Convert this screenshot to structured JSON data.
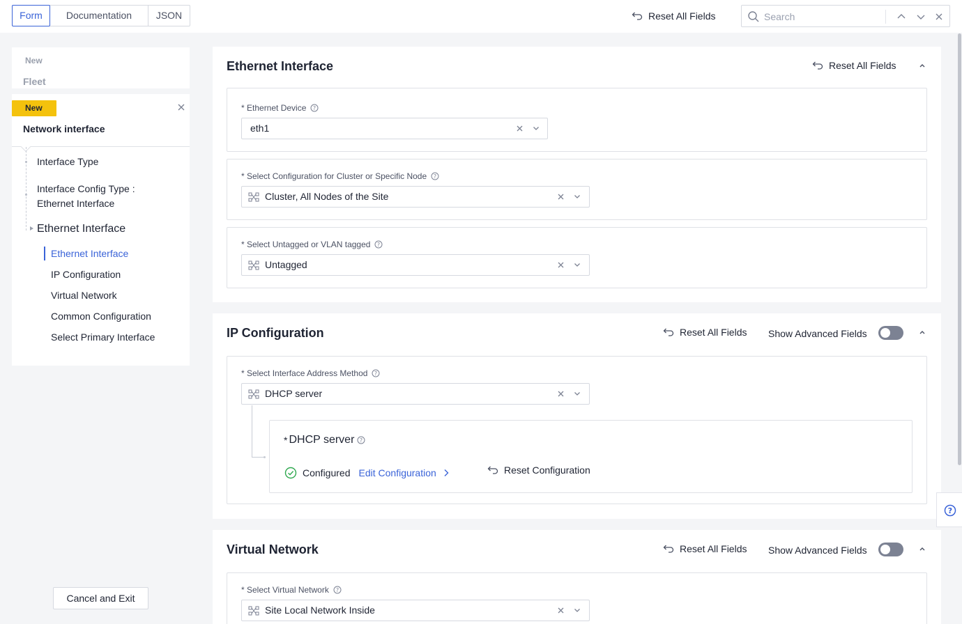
{
  "topbar": {
    "tabs": [
      {
        "label": "Form"
      },
      {
        "label": "Documentation"
      },
      {
        "label": "JSON"
      }
    ],
    "reset_all_label": "Reset All Fields",
    "search_placeholder": "Search"
  },
  "sidebar": {
    "previous_badge": "New",
    "previous_title": "Fleet",
    "current_badge": "New",
    "current_title": "Network interface",
    "tree": [
      {
        "label": "Interface Type"
      },
      {
        "label": "Interface Config Type :"
      },
      {
        "label": "Ethernet Interface"
      },
      {
        "label": "Ethernet Interface"
      }
    ],
    "sub_items": [
      {
        "label": "Ethernet Interface"
      },
      {
        "label": "IP Configuration"
      },
      {
        "label": "Virtual Network"
      },
      {
        "label": "Common Configuration"
      },
      {
        "label": "Select Primary Interface"
      }
    ],
    "cancel_label": "Cancel and Exit"
  },
  "ethernet_panel": {
    "title": "Ethernet Interface",
    "reset_label": "Reset All Fields",
    "fields": [
      {
        "label": "* Ethernet Device",
        "value": "eth1"
      },
      {
        "label": "* Select Configuration for Cluster or Specific Node",
        "value": "Cluster, All Nodes of the Site"
      },
      {
        "label": "* Select Untagged or VLAN tagged",
        "value": "Untagged"
      }
    ]
  },
  "ip_panel": {
    "title": "IP Configuration",
    "reset_label": "Reset All Fields",
    "advanced_label": "Show Advanced Fields",
    "advanced_enabled": false,
    "field_label": "* Select Interface Address Method",
    "field_value": "DHCP server",
    "sub_card": {
      "title_prefix": "*",
      "title": "DHCP server",
      "status": "Configured",
      "edit_label": "Edit Configuration",
      "reset_label": "Reset Configuration"
    }
  },
  "vn_panel": {
    "title": "Virtual Network",
    "reset_label": "Reset All Fields",
    "advanced_label": "Show Advanced Fields",
    "advanced_enabled": false,
    "field_label": "* Select Virtual Network",
    "field_value": "Site Local Network Inside"
  },
  "colors": {
    "accent": "#3a63d8",
    "badge": "#f4c20d",
    "success": "#2fa84f"
  }
}
